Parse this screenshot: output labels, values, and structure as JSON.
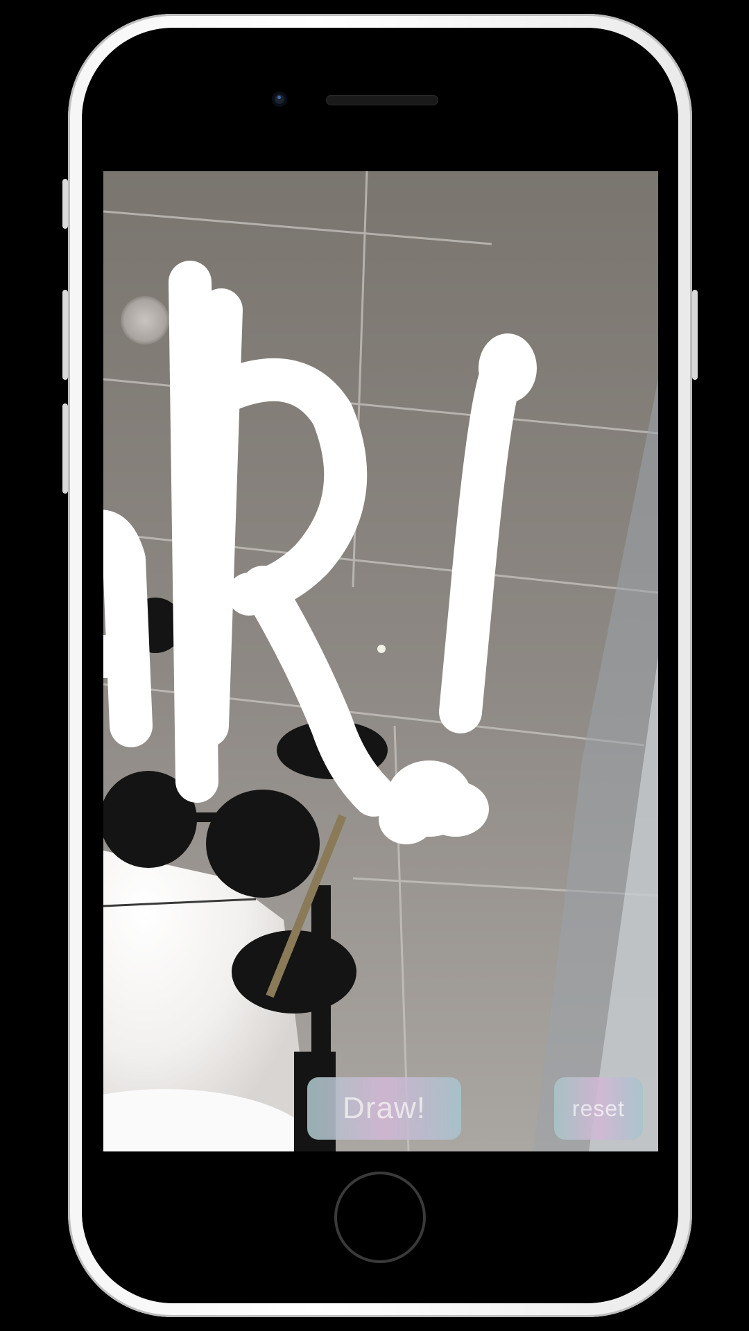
{
  "app": {
    "draw_button_label": "Draw!",
    "reset_button_label": "reset"
  },
  "colors": {
    "device_frame": "#f4f4f4",
    "button_gradient_start": "#a9c6c9",
    "button_gradient_mid": "#d3b8d6",
    "stroke": "#ffffff"
  },
  "icons": {
    "home": "home-button-icon",
    "camera": "front-camera-icon",
    "speaker": "earpiece-speaker-icon"
  }
}
